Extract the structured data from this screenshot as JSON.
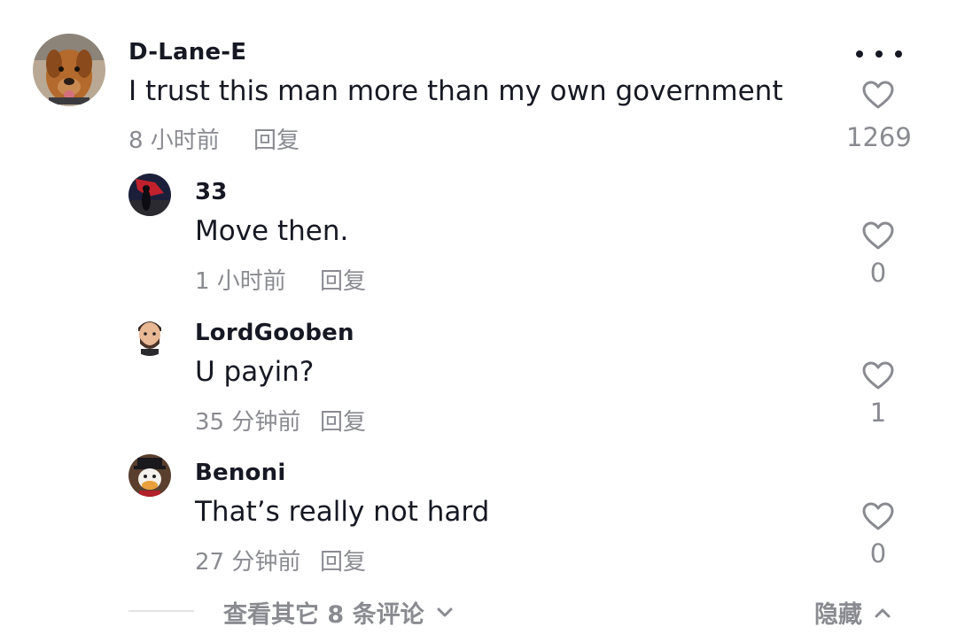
{
  "comments": [
    {
      "username": "D-Lane-E",
      "text": "I trust this man more than my own government",
      "time": "8 小时前",
      "reply": "回复",
      "likes": "1269"
    },
    {
      "username": "33",
      "text": "Move then.",
      "time": "1 小时前",
      "reply": "回复",
      "likes": "0"
    },
    {
      "username": "LordGooben",
      "text": "U payin?",
      "time": "35 分钟前",
      "reply": "回复",
      "likes": "1"
    },
    {
      "username": "Benoni",
      "text": "That’s really not hard",
      "time": "27 分钟前",
      "reply": "回复",
      "likes": "0"
    }
  ],
  "footer": {
    "view_more": "查看其它 8 条评论",
    "hide": "隐藏"
  },
  "icons": {
    "like": "heart-outline-icon",
    "more": "more-horizontal-icon",
    "expand": "chevron-down-icon",
    "collapse": "chevron-up-icon"
  }
}
